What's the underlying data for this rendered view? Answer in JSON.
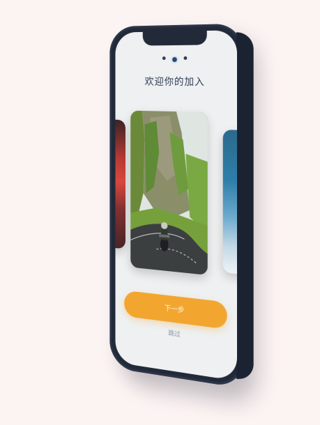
{
  "onboarding": {
    "title": "欢迎你的加入",
    "pagination": {
      "total": 3,
      "active_index": 1
    },
    "next_label": "下一步",
    "skip_label": "跳过"
  },
  "cards": [
    {
      "name": "card-red-car",
      "image": "red-vehicle-photo"
    },
    {
      "name": "card-motorcycle-road",
      "image": "motorcyclist-mountain-road-photo"
    },
    {
      "name": "card-blue-sky",
      "image": "blue-sky-clouds-photo"
    }
  ],
  "colors": {
    "background": "#fcf3f3",
    "phone_body": "#222a3a",
    "screen": "#eef0f1",
    "accent_button": "#f2a630",
    "title_text": "#2f3b55"
  }
}
